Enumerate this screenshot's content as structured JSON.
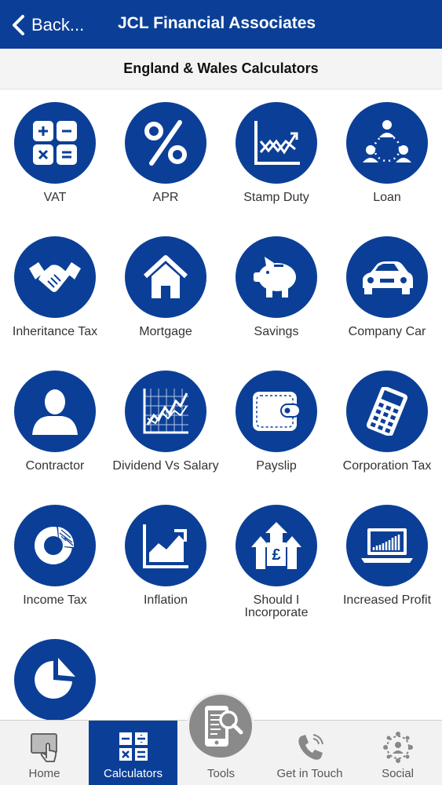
{
  "header": {
    "back_label": "Back...",
    "title": "JCL Financial Associates"
  },
  "subheader": {
    "title": "England & Wales Calculators"
  },
  "calculators": [
    {
      "label": "VAT",
      "icon": "calculator-keys-icon"
    },
    {
      "label": "APR",
      "icon": "percent-icon"
    },
    {
      "label": "Stamp Duty",
      "icon": "trend-chart-icon"
    },
    {
      "label": "Loan",
      "icon": "people-network-icon"
    },
    {
      "label": "Inheritance Tax",
      "icon": "handshake-icon"
    },
    {
      "label": "Mortgage",
      "icon": "house-icon"
    },
    {
      "label": "Savings",
      "icon": "piggy-bank-icon"
    },
    {
      "label": "Company Car",
      "icon": "car-icon"
    },
    {
      "label": "Contractor",
      "icon": "person-icon"
    },
    {
      "label": "Dividend Vs Salary",
      "icon": "stock-graph-icon"
    },
    {
      "label": "Payslip",
      "icon": "wallet-icon"
    },
    {
      "label": "Corporation Tax",
      "icon": "calculator-icon"
    },
    {
      "label": "Income Tax",
      "icon": "donut-chart-icon"
    },
    {
      "label": "Inflation",
      "icon": "rising-chart-icon"
    },
    {
      "label": "Should I Incorporate",
      "icon": "pound-arrows-icon"
    },
    {
      "label": "Increased Profit",
      "icon": "laptop-chart-icon"
    },
    {
      "label": "",
      "icon": "pie-chart-icon"
    }
  ],
  "tabbar": {
    "home": "Home",
    "calculators": "Calculators",
    "tools": "Tools",
    "get_in_touch": "Get in Touch",
    "social": "Social"
  },
  "colors": {
    "brand_blue": "#0b3f97",
    "tab_bg": "#f2f2f2",
    "fab_grey": "#8a8a8a"
  }
}
